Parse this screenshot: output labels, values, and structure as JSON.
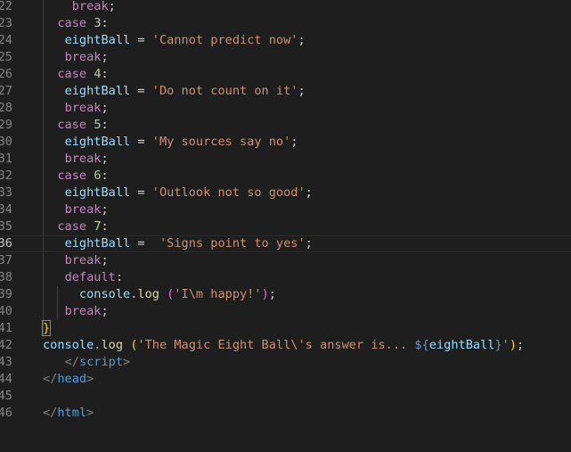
{
  "editor": {
    "active_line": "36",
    "lines": [
      {
        "n": "22",
        "parts": [
          {
            "t": "    ",
            "c": ""
          },
          {
            "t": "break",
            "c": "kw-ctrl"
          },
          {
            "t": ";",
            "c": "punc"
          }
        ]
      },
      {
        "n": "23",
        "parts": [
          {
            "t": "  ",
            "c": ""
          },
          {
            "t": "case",
            "c": "kw-ctrl"
          },
          {
            "t": " ",
            "c": ""
          },
          {
            "t": "3",
            "c": "num"
          },
          {
            "t": ":",
            "c": "punc"
          }
        ]
      },
      {
        "n": "24",
        "parts": [
          {
            "t": "   ",
            "c": ""
          },
          {
            "t": "eightBall",
            "c": "var"
          },
          {
            "t": " = ",
            "c": "punc"
          },
          {
            "t": "'Cannot predict now'",
            "c": "str"
          },
          {
            "t": ";",
            "c": "punc"
          }
        ]
      },
      {
        "n": "25",
        "parts": [
          {
            "t": "   ",
            "c": ""
          },
          {
            "t": "break",
            "c": "kw-ctrl"
          },
          {
            "t": ";",
            "c": "punc"
          }
        ]
      },
      {
        "n": "26",
        "parts": [
          {
            "t": "  ",
            "c": ""
          },
          {
            "t": "case",
            "c": "kw-ctrl"
          },
          {
            "t": " ",
            "c": ""
          },
          {
            "t": "4",
            "c": "num"
          },
          {
            "t": ":",
            "c": "punc"
          }
        ]
      },
      {
        "n": "27",
        "parts": [
          {
            "t": "   ",
            "c": ""
          },
          {
            "t": "eightBall",
            "c": "var"
          },
          {
            "t": " = ",
            "c": "punc"
          },
          {
            "t": "'Do not count on it'",
            "c": "str"
          },
          {
            "t": ";",
            "c": "punc"
          }
        ]
      },
      {
        "n": "28",
        "parts": [
          {
            "t": "   ",
            "c": ""
          },
          {
            "t": "break",
            "c": "kw-ctrl"
          },
          {
            "t": ";",
            "c": "punc"
          }
        ]
      },
      {
        "n": "29",
        "parts": [
          {
            "t": "  ",
            "c": ""
          },
          {
            "t": "case",
            "c": "kw-ctrl"
          },
          {
            "t": " ",
            "c": ""
          },
          {
            "t": "5",
            "c": "num"
          },
          {
            "t": ":",
            "c": "punc"
          }
        ]
      },
      {
        "n": "30",
        "parts": [
          {
            "t": "   ",
            "c": ""
          },
          {
            "t": "eightBall",
            "c": "var"
          },
          {
            "t": " = ",
            "c": "punc"
          },
          {
            "t": "'My sources say no'",
            "c": "str"
          },
          {
            "t": ";",
            "c": "punc"
          }
        ]
      },
      {
        "n": "31",
        "parts": [
          {
            "t": "   ",
            "c": ""
          },
          {
            "t": "break",
            "c": "kw-ctrl"
          },
          {
            "t": ";",
            "c": "punc"
          }
        ]
      },
      {
        "n": "32",
        "parts": [
          {
            "t": "  ",
            "c": ""
          },
          {
            "t": "case",
            "c": "kw-ctrl"
          },
          {
            "t": " ",
            "c": ""
          },
          {
            "t": "6",
            "c": "num"
          },
          {
            "t": ":",
            "c": "punc"
          }
        ]
      },
      {
        "n": "33",
        "parts": [
          {
            "t": "   ",
            "c": ""
          },
          {
            "t": "eightBall",
            "c": "var"
          },
          {
            "t": " = ",
            "c": "punc"
          },
          {
            "t": "'Outlook not so good'",
            "c": "str"
          },
          {
            "t": ";",
            "c": "punc"
          }
        ]
      },
      {
        "n": "34",
        "parts": [
          {
            "t": "   ",
            "c": ""
          },
          {
            "t": "break",
            "c": "kw-ctrl"
          },
          {
            "t": ";",
            "c": "punc"
          }
        ]
      },
      {
        "n": "35",
        "parts": [
          {
            "t": "  ",
            "c": ""
          },
          {
            "t": "case",
            "c": "kw-ctrl"
          },
          {
            "t": " ",
            "c": ""
          },
          {
            "t": "7",
            "c": "num"
          },
          {
            "t": ":",
            "c": "punc"
          }
        ]
      },
      {
        "n": "36",
        "parts": [
          {
            "t": "   ",
            "c": ""
          },
          {
            "t": "eightBall",
            "c": "var"
          },
          {
            "t": " =  ",
            "c": "punc"
          },
          {
            "t": "'Signs point to yes'",
            "c": "str"
          },
          {
            "t": ";",
            "c": "punc"
          }
        ]
      },
      {
        "n": "37",
        "parts": [
          {
            "t": "   ",
            "c": ""
          },
          {
            "t": "break",
            "c": "kw-ctrl"
          },
          {
            "t": ";",
            "c": "punc"
          }
        ]
      },
      {
        "n": "38",
        "parts": [
          {
            "t": "   ",
            "c": ""
          },
          {
            "t": "default",
            "c": "kw-ctrl"
          },
          {
            "t": ":",
            "c": "punc"
          }
        ]
      },
      {
        "n": "39",
        "parts": [
          {
            "t": "     ",
            "c": ""
          },
          {
            "t": "console",
            "c": "var"
          },
          {
            "t": ".",
            "c": "punc"
          },
          {
            "t": "log",
            "c": "fn"
          },
          {
            "t": " ",
            "c": ""
          },
          {
            "t": "(",
            "c": "bracket1"
          },
          {
            "t": "'I\\m happy!'",
            "c": "str"
          },
          {
            "t": ")",
            "c": "bracket1"
          },
          {
            "t": ";",
            "c": "punc"
          }
        ]
      },
      {
        "n": "40",
        "parts": [
          {
            "t": "   ",
            "c": ""
          },
          {
            "t": "break",
            "c": "kw-ctrl"
          },
          {
            "t": ";",
            "c": "punc"
          }
        ]
      },
      {
        "n": "41",
        "parts": [
          {
            "t": "}",
            "c": "bracket-match"
          }
        ]
      },
      {
        "n": "42",
        "parts": [
          {
            "t": "console",
            "c": "var"
          },
          {
            "t": ".",
            "c": "punc"
          },
          {
            "t": "log",
            "c": "fn"
          },
          {
            "t": " ",
            "c": ""
          },
          {
            "t": "(",
            "c": "bracket2"
          },
          {
            "t": "'The Magic Eight Ball\\'s answer is... ",
            "c": "str"
          },
          {
            "t": "${",
            "c": "tpl-brace"
          },
          {
            "t": "eightBall",
            "c": "var"
          },
          {
            "t": "}",
            "c": "tpl-brace"
          },
          {
            "t": "'",
            "c": "str"
          },
          {
            "t": ")",
            "c": "bracket2"
          },
          {
            "t": ";",
            "c": "punc"
          }
        ]
      },
      {
        "n": "43",
        "parts": [
          {
            "t": "   ",
            "c": ""
          },
          {
            "t": "</",
            "c": "tagbr"
          },
          {
            "t": "script",
            "c": "tag"
          },
          {
            "t": ">",
            "c": "tagbr"
          }
        ]
      },
      {
        "n": "44",
        "parts": [
          {
            "t": "</",
            "c": "tagbr"
          },
          {
            "t": "head",
            "c": "tag"
          },
          {
            "t": ">",
            "c": "tagbr"
          }
        ]
      },
      {
        "n": "45",
        "parts": []
      },
      {
        "n": "46",
        "parts": [
          {
            "t": "</",
            "c": "tagbr"
          },
          {
            "t": "html",
            "c": "tag"
          },
          {
            "t": ">",
            "c": "tagbr"
          }
        ]
      }
    ]
  }
}
